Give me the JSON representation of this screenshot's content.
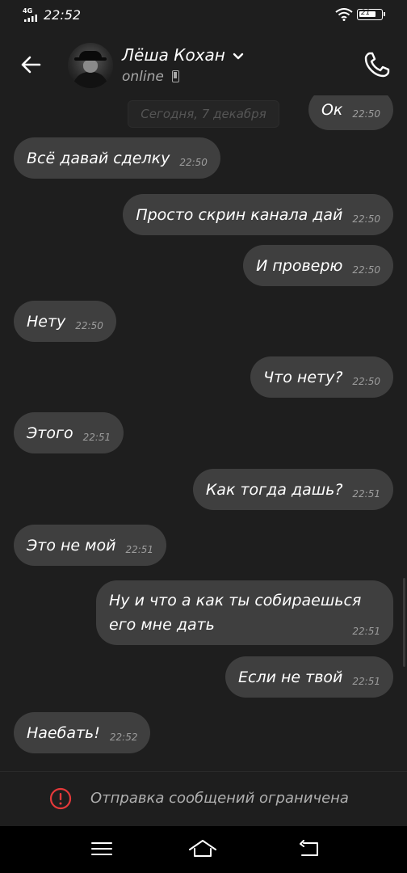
{
  "status_bar": {
    "network": "4G",
    "time": "22:52",
    "battery": "21",
    "icons": [
      "signal-icon",
      "wifi-icon",
      "battery-icon"
    ]
  },
  "header": {
    "back_icon": "arrow-left-icon",
    "contact_name": "Лёша Кохан",
    "status": "online",
    "call_icon": "phone-icon"
  },
  "chat": {
    "date_label": "Сегодня, 7 декабря",
    "messages": [
      {
        "text": "Ок",
        "time": "22:50",
        "outgoing": true
      },
      {
        "text": "Всё давай сделку",
        "time": "22:50",
        "outgoing": false
      },
      {
        "text": "Просто скрин канала дай",
        "time": "22:50",
        "outgoing": true
      },
      {
        "text": "И проверю",
        "time": "22:50",
        "outgoing": true
      },
      {
        "text": "Нету",
        "time": "22:50",
        "outgoing": false
      },
      {
        "text": "Что нету?",
        "time": "22:50",
        "outgoing": true
      },
      {
        "text": "Этого",
        "time": "22:51",
        "outgoing": false
      },
      {
        "text": "Как тогда дашь?",
        "time": "22:51",
        "outgoing": true
      },
      {
        "text": "Это не мой",
        "time": "22:51",
        "outgoing": false
      },
      {
        "text_line1": "Ну и что а как ты собираешься",
        "text_line2": "его мне дать",
        "time": "22:51",
        "outgoing": true
      },
      {
        "text": "Если не твой",
        "time": "22:51",
        "outgoing": true
      },
      {
        "text": "Наебать!",
        "time": "22:52",
        "outgoing": false
      }
    ]
  },
  "restriction": {
    "icon": "alert-circle-icon",
    "text": "Отправка сообщений ограничена",
    "color": "#e5393a"
  },
  "nav": {
    "icons": [
      "menu-icon",
      "home-icon",
      "back-icon"
    ]
  },
  "colors": {
    "background": "#1e1e1e",
    "bubble": "#3f3f3f",
    "alert": "#e5393a"
  }
}
